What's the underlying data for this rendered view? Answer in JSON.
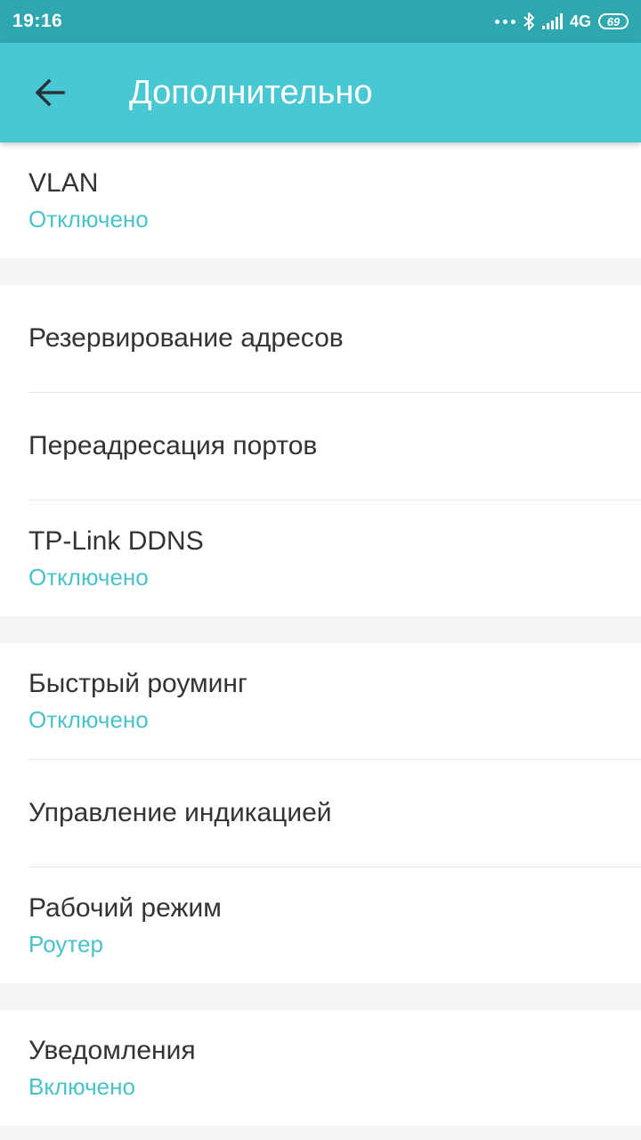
{
  "status_bar": {
    "time": "19:16",
    "network": "4G",
    "battery": "69"
  },
  "app_bar": {
    "title": "Дополнительно"
  },
  "groups": [
    {
      "items": [
        {
          "label": "VLAN",
          "value": "Отключено"
        }
      ]
    },
    {
      "items": [
        {
          "label": "Резервирование адресов"
        },
        {
          "label": "Переадресация портов"
        },
        {
          "label": "TP-Link DDNS",
          "value": "Отключено"
        }
      ]
    },
    {
      "items": [
        {
          "label": "Быстрый роуминг",
          "value": "Отключено"
        },
        {
          "label": "Управление индикацией"
        },
        {
          "label": "Рабочий режим",
          "value": "Роутер"
        }
      ]
    },
    {
      "items": [
        {
          "label": "Уведомления",
          "value": "Включено"
        }
      ]
    }
  ],
  "colors": {
    "status_bar": "#2fa7ae",
    "app_bar": "#49c8d3",
    "accent_value": "#49c3c8"
  },
  "icons": {
    "back": "arrow-left-icon",
    "bluetooth": "bluetooth-icon",
    "signal": "signal-icon",
    "battery": "battery-icon"
  }
}
